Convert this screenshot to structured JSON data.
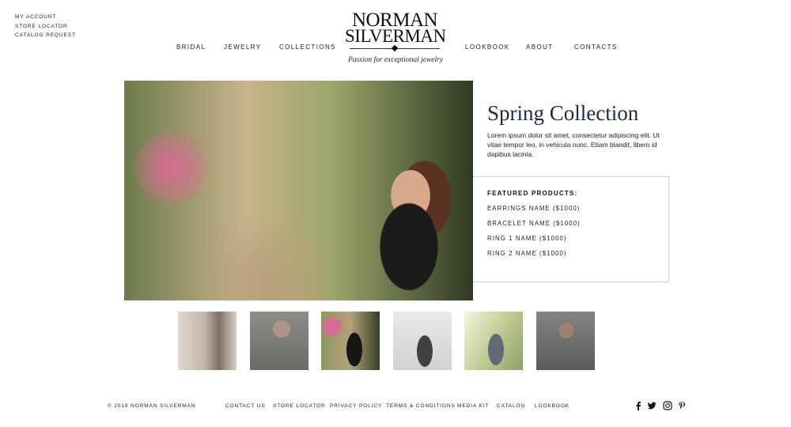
{
  "utility_links": [
    "MY ACCOUNT",
    "STORE LOCATOR",
    "CATALOG REQUEST"
  ],
  "nav_left": [
    "BRIDAL",
    "JEWELRY",
    "COLLECTIONS"
  ],
  "nav_right": [
    "LOOKBOOK",
    "ABOUT",
    "CONTACTS"
  ],
  "logo": {
    "line1": "NORMAN",
    "line2": "SILVERMAN",
    "tagline": "Passion for exceptional jewelry"
  },
  "hero": {
    "title": "Spring Collection",
    "description": "Lorem ipsum dolor sit amet, consectetur adipiscing elit. Ut vitae tempor leo, in vehicula nunc. Etiam blandit, libero id dapibus lacinia."
  },
  "featured": {
    "heading": "FEATURED PRODUCTS:",
    "items": [
      "EARRINGS NAME ($1000)",
      "BRACELET NAME ($1000)",
      "RING 1 NAME ($1000)",
      "RING 2 NAME ($1000)"
    ]
  },
  "footer": {
    "copyright": "© 2018 NORMAN SILVERMAN",
    "links": [
      "CONTACT US",
      "STORE LOCATOR",
      "PRIVACY POLICY",
      "TERMS & CONDITIONS",
      "MEDIA KIT",
      "CATALOG",
      "LOOKBOOK"
    ]
  },
  "social_icons": [
    "facebook-icon",
    "twitter-icon",
    "instagram-icon",
    "pinterest-icon"
  ],
  "colors": {
    "title": "#1e2b45",
    "text": "#222222",
    "border": "#d4d4d4"
  }
}
